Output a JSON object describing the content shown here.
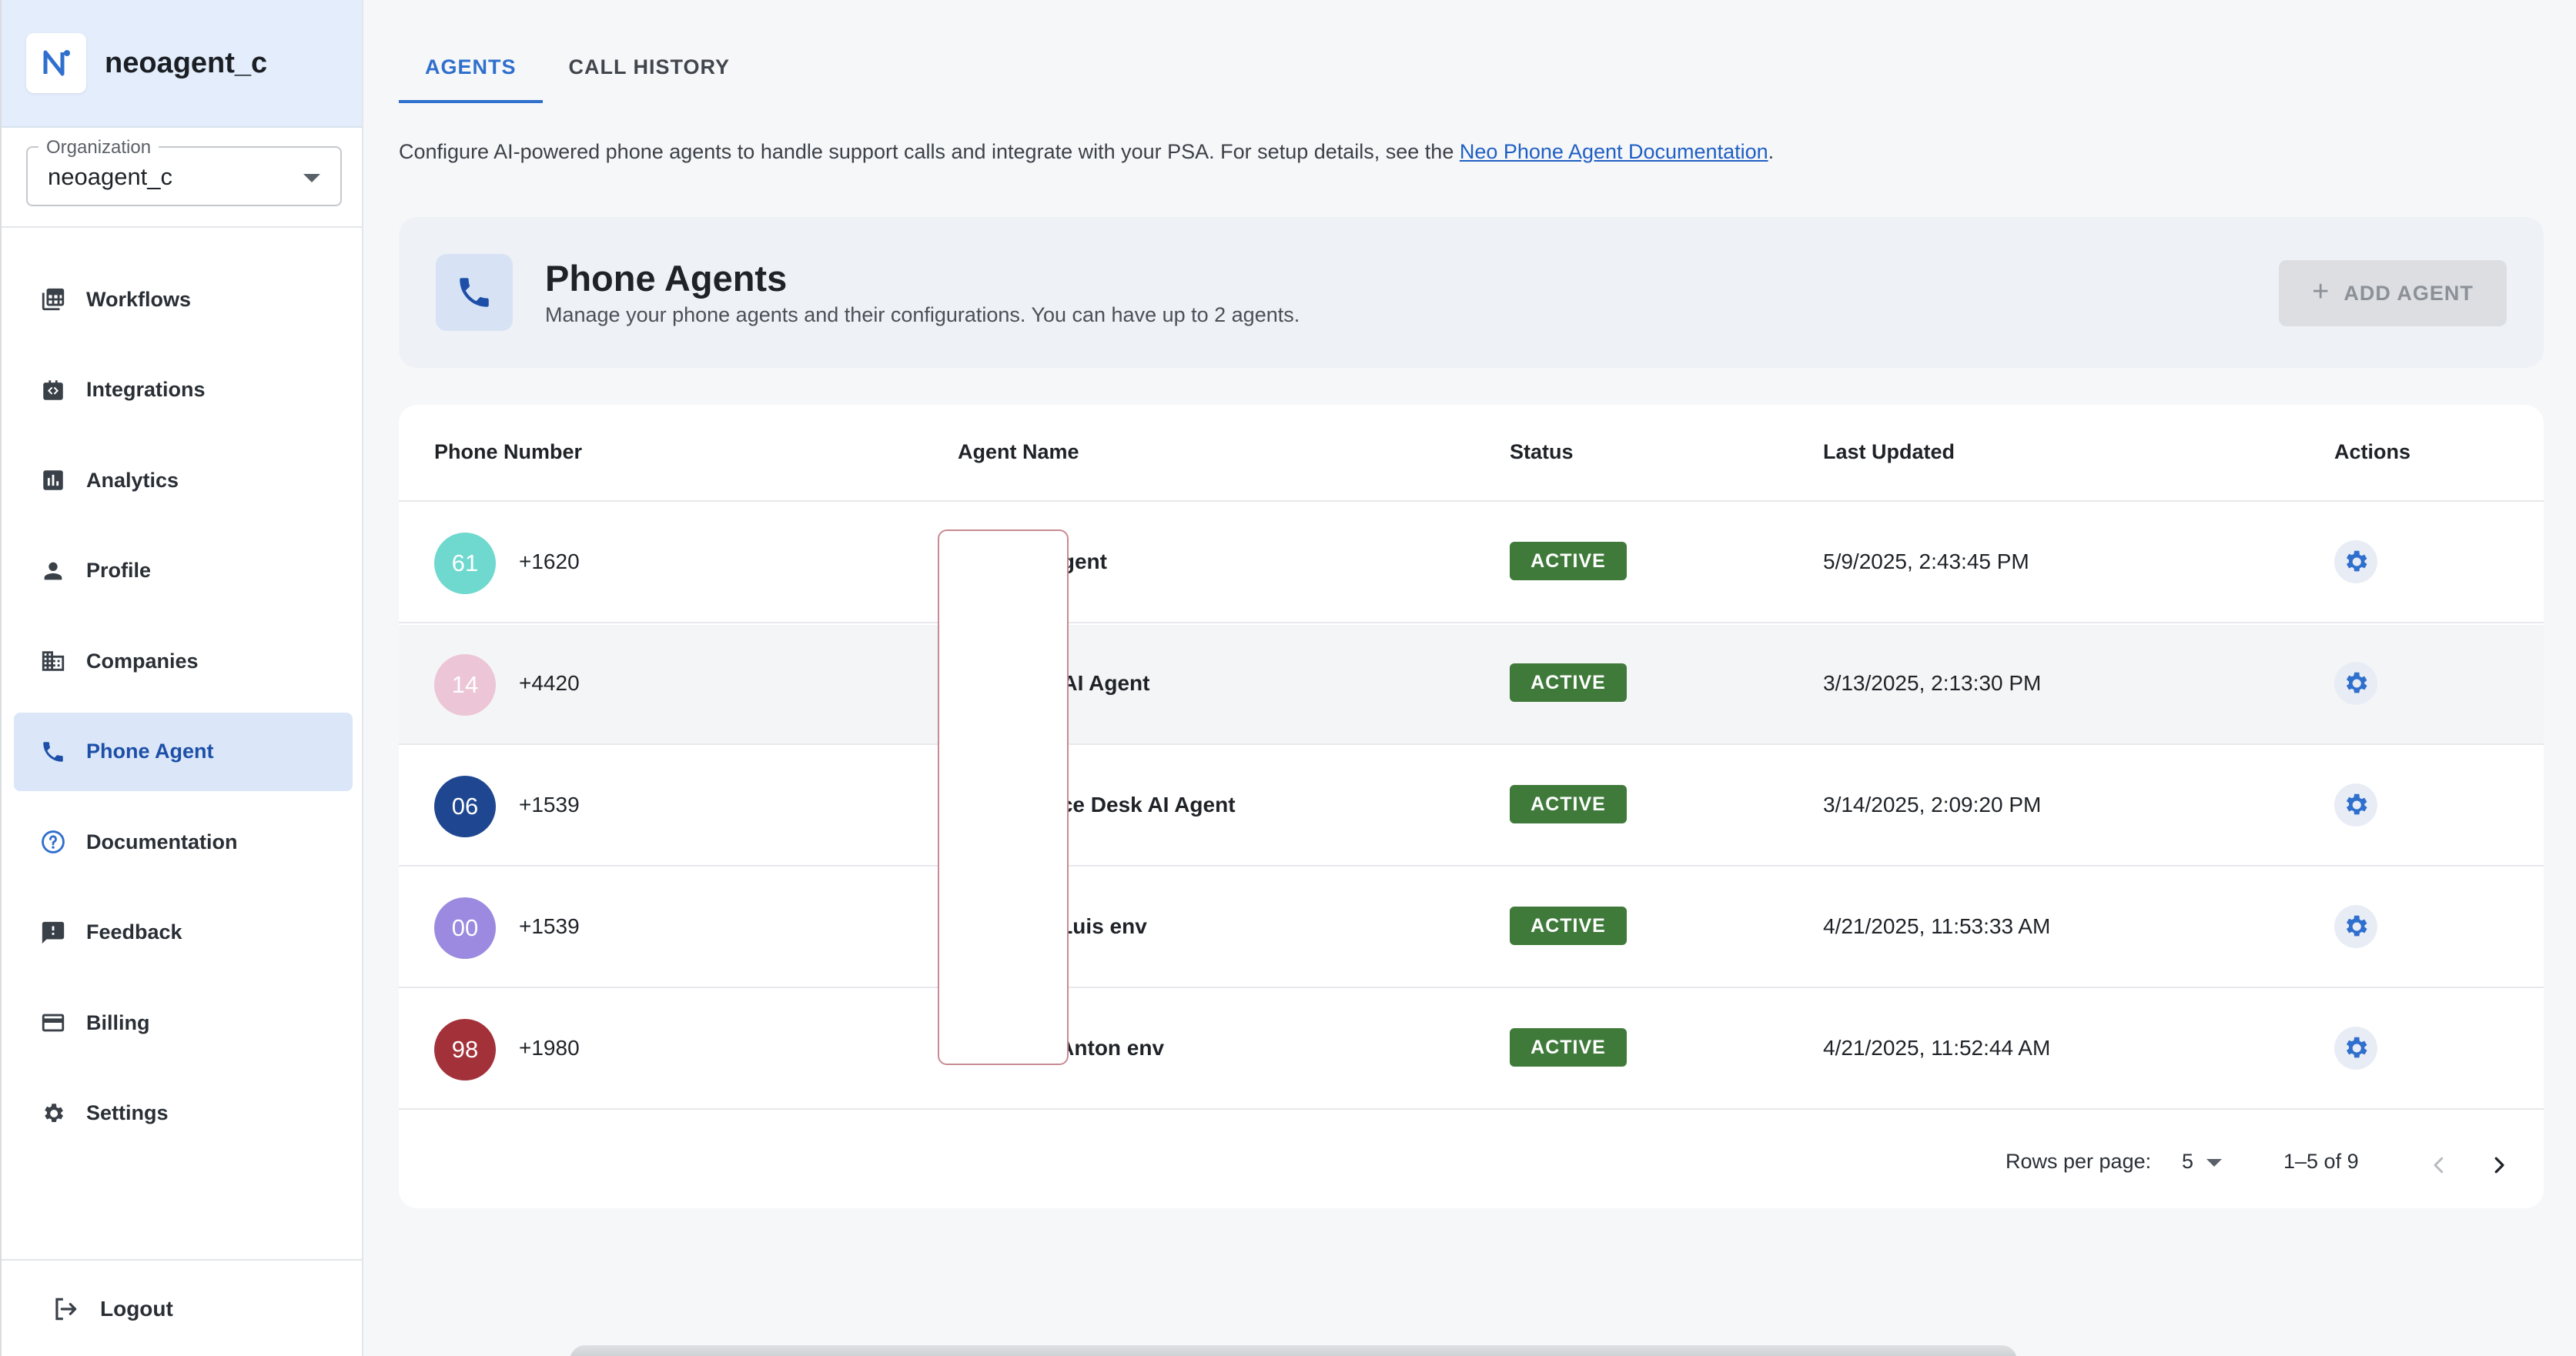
{
  "brand": {
    "name": "neoagent_c"
  },
  "organization": {
    "label": "Organization",
    "value": "neoagent_c"
  },
  "nav": {
    "items": [
      {
        "label": "Workflows",
        "icon": "workflows-icon"
      },
      {
        "label": "Integrations",
        "icon": "integrations-icon"
      },
      {
        "label": "Analytics",
        "icon": "analytics-icon"
      },
      {
        "label": "Profile",
        "icon": "person-icon"
      },
      {
        "label": "Companies",
        "icon": "building-icon"
      },
      {
        "label": "Phone Agent",
        "icon": "phone-icon",
        "active": true
      },
      {
        "label": "Documentation",
        "icon": "help-circle-icon"
      },
      {
        "label": "Feedback",
        "icon": "feedback-icon"
      },
      {
        "label": "Billing",
        "icon": "credit-card-icon"
      },
      {
        "label": "Settings",
        "icon": "gear-icon"
      }
    ],
    "logout": "Logout"
  },
  "tabs": [
    {
      "label": "AGENTS",
      "active": true
    },
    {
      "label": "CALL HISTORY",
      "active": false
    }
  ],
  "description": {
    "text": "Configure AI-powered phone agents to handle support calls and integrate with your PSA. For setup details, see the ",
    "link": "Neo Phone Agent Documentation",
    "suffix": "."
  },
  "agents_card": {
    "title": "Phone Agents",
    "subtitle": "Manage your phone agents and their configurations. You can have up to 2 agents.",
    "add_button": "ADD AGENT"
  },
  "table": {
    "headers": [
      "Phone Number",
      "Agent Name",
      "Status",
      "Last Updated",
      "Actions"
    ],
    "rows": [
      {
        "avatar": "61",
        "avatar_color": "#6fd9cf",
        "phone": "+1620",
        "agent": "Sales AI Agent",
        "status": "ACTIVE",
        "updated": "5/9/2025, 2:43:45 PM"
      },
      {
        "avatar": "14",
        "avatar_color": "#ecc6d6",
        "phone": "+4420",
        "agent": "Voicemail AI Agent",
        "status": "ACTIVE",
        "updated": "3/13/2025, 2:13:30 PM"
      },
      {
        "avatar": "06",
        "avatar_color": "#1f4690",
        "phone": "+1539",
        "agent": "DEV Service Desk AI Agent",
        "status": "ACTIVE",
        "updated": "3/14/2025, 2:09:20 PM"
      },
      {
        "avatar": "00",
        "avatar_color": "#9b8ae0",
        "phone": "+1539",
        "agent": "Agent for Luis env",
        "status": "ACTIVE",
        "updated": "4/21/2025, 11:53:33 AM"
      },
      {
        "avatar": "98",
        "avatar_color": "#a3313a",
        "phone": "+1980",
        "agent": "Agent for Anton env",
        "status": "ACTIVE",
        "updated": "4/21/2025, 11:52:44 AM"
      }
    ]
  },
  "pagination": {
    "rows_label": "Rows per page:",
    "rows_value": "5",
    "range": "1–5 of 9"
  },
  "colors": {
    "accent": "#2f6fcd",
    "active_nav_bg": "#dbe7f8",
    "status_active": "#3f7a3a"
  }
}
